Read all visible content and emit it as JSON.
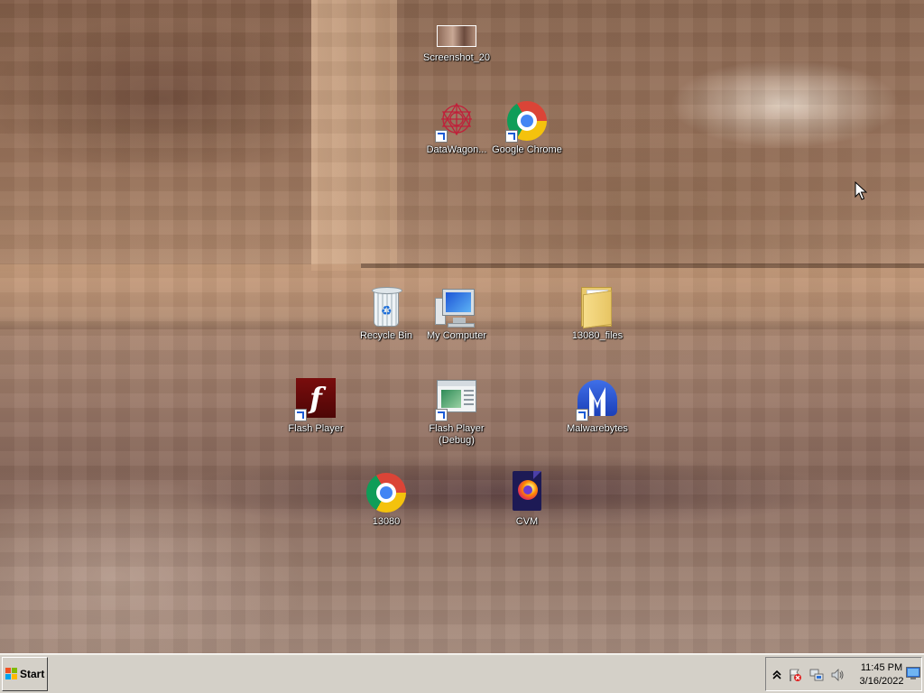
{
  "desktop": {
    "icons": {
      "screenshot": "Screenshot_20",
      "datawagon": "DataWagon...",
      "chrome": "Google Chrome",
      "recycle_bin": "Recycle Bin",
      "my_computer": "My Computer",
      "files_13080": "13080_files",
      "flash_player": "Flash Player",
      "flash_player_debug": "Flash Player\n(Debug)",
      "malwarebytes": "Malwarebytes",
      "chrome_13080": "13080",
      "cvm": "CVM"
    }
  },
  "taskbar": {
    "start_label": "Start",
    "clock_time": "11:45 PM",
    "clock_date": "3/16/2022"
  },
  "colors": {
    "taskbar": "#d4d0c8",
    "label_text": "#ffffff"
  }
}
